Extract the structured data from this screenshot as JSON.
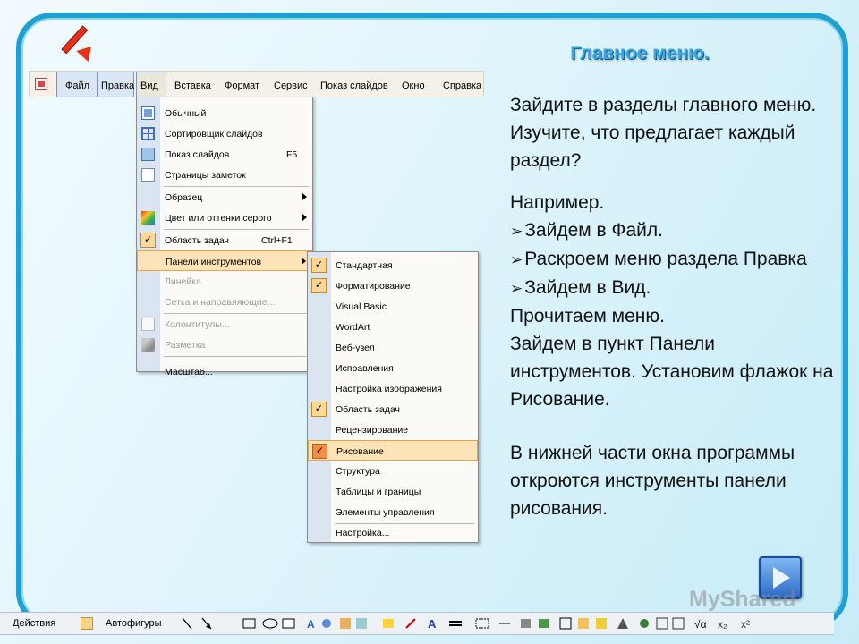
{
  "slide": {
    "title": "Главное меню.",
    "para1": "Зайдите в разделы главного меню. Изучите, что предлагает каждый раздел?",
    "example_lead": "Например.",
    "bullets": [
      "Зайдем в Файл.",
      "Раскроем меню раздела Правка",
      "Зайдем в Вид."
    ],
    "after_bullets": [
      "Прочитаем меню.",
      "Зайдем в пункт Панели инструментов. Установим флажок на Рисование."
    ],
    "para_last": "В нижней части окна программы откроются инструменты панели рисования."
  },
  "menubar": {
    "items": [
      "Файл",
      "Правка",
      "Вид",
      "Вставка",
      "Формат",
      "Сервис",
      "Показ слайдов",
      "Окно",
      "Справка"
    ]
  },
  "view_menu": {
    "items": [
      {
        "label": "Обычный",
        "icon": "normal-view-icon"
      },
      {
        "label": "Сортировщик слайдов",
        "icon": "slide-sorter-icon"
      },
      {
        "label": "Показ слайдов",
        "shortcut": "F5",
        "icon": "slideshow-icon"
      },
      {
        "label": "Страницы заметок",
        "icon": "notes-page-icon"
      },
      {
        "label": "Образец",
        "submenu": true
      },
      {
        "label": "Цвет или оттенки серого",
        "submenu": true,
        "icon": "color-icon"
      },
      {
        "label": "Область задач",
        "shortcut": "Ctrl+F1",
        "checked": true
      },
      {
        "label": "Панели инструментов",
        "submenu": true,
        "highlighted": true
      },
      {
        "label": "Линейка",
        "disabled": true
      },
      {
        "label": "Сетка и направляющие...",
        "disabled": true
      },
      {
        "label": "Колонтитулы...",
        "disabled": true,
        "icon": "header-footer-icon"
      },
      {
        "label": "Разметка",
        "disabled": true,
        "icon": "markup-icon"
      },
      {
        "label": "Масштаб..."
      }
    ]
  },
  "toolbars_submenu": {
    "items": [
      {
        "label": "Стандартная",
        "checked": true
      },
      {
        "label": "Форматирование",
        "checked": true
      },
      {
        "label": "Visual Basic"
      },
      {
        "label": "WordArt"
      },
      {
        "label": "Веб-узел"
      },
      {
        "label": "Исправления"
      },
      {
        "label": "Настройка изображения"
      },
      {
        "label": "Область задач",
        "checked": true
      },
      {
        "label": "Рецензирование"
      },
      {
        "label": "Рисование",
        "checked": true,
        "highlighted": true
      },
      {
        "label": "Структура"
      },
      {
        "label": "Таблицы и границы"
      },
      {
        "label": "Элементы управления"
      },
      {
        "label": "Настройка..."
      }
    ]
  },
  "toolbar": {
    "actions_label": "Действия",
    "autoshapes_label": "Автофигуры"
  },
  "watermark": "MyShared"
}
